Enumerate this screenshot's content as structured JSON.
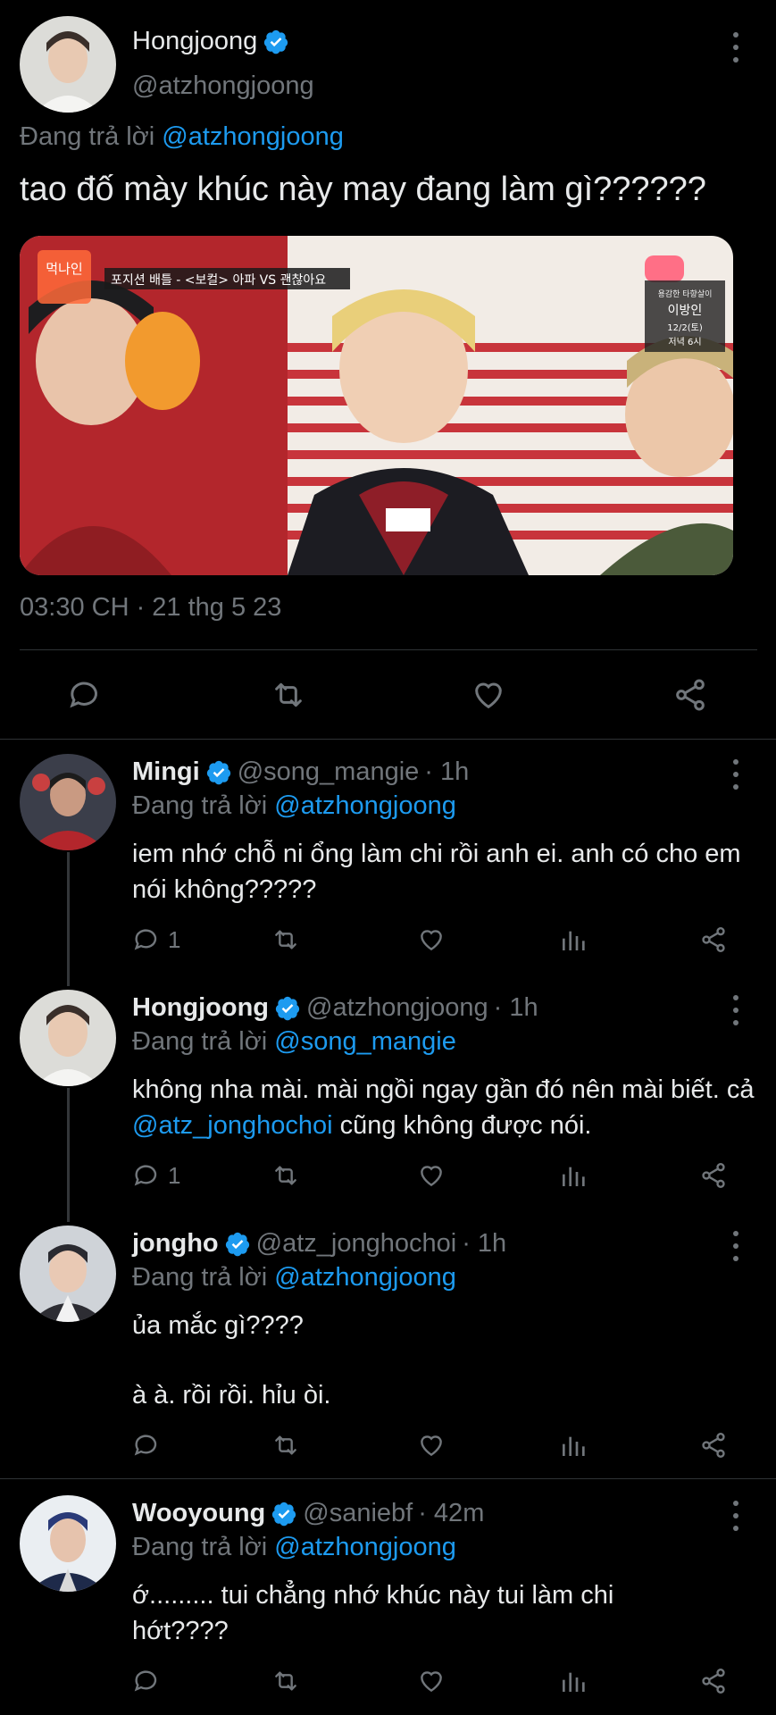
{
  "main_tweet": {
    "name": "Hongjoong",
    "handle": "@atzhongjoong",
    "replying_prefix": "Đang trả lời",
    "replying_to": "@atzhongjoong",
    "text": "tao đố mày khúc này may đang làm gì??????",
    "media_overlay": {
      "top_left_badge": "먹나인",
      "banner": "포지션 배틀 - <보컬> 아파 VS 괜찮아요",
      "top_right_small": "용감한 타향살이",
      "top_right_name": "이방인",
      "top_right_date": "12/2(토)",
      "top_right_time": "저녁 6시"
    },
    "timestamp": "03:30 CH · 21 thg 5 23"
  },
  "replies": [
    {
      "name": "Mingi",
      "handle": "@song_mangie",
      "time": "· 1h",
      "replying_prefix": "Đang trả lời",
      "replying_to": "@atzhongjoong",
      "text": "iem nhớ chỗ ni ổng làm chi rồi anh ei. anh có cho em nói không?????",
      "reply_count": "1"
    },
    {
      "name": "Hongjoong",
      "handle": "@atzhongjoong",
      "time": "· 1h",
      "replying_prefix": "Đang trả lời",
      "replying_to": "@song_mangie",
      "text_before": "không nha mài. mài ngồi ngay gần đó nên mài biết. cả ",
      "text_mention": "@atz_jonghochoi",
      "text_after": " cũng không được nói.",
      "reply_count": "1"
    },
    {
      "name": "jongho",
      "handle": "@atz_jonghochoi",
      "time": "· 1h",
      "replying_prefix": "Đang trả lời",
      "replying_to": "@atzhongjoong",
      "text_line1": "ủa mắc gì????",
      "text_line2": "à à. rồi rồi. hỉu òi.",
      "reply_count": ""
    },
    {
      "name": "Wooyoung",
      "handle": "@saniebf",
      "time": "· 42m",
      "replying_prefix": "Đang trả lời",
      "replying_to": "@atzhongjoong",
      "text": "ớ......... tui chẳng nhớ khúc này tui làm chi hớt????",
      "reply_count": ""
    }
  ],
  "colors": {
    "background": "#000000",
    "text": "#e7e9ea",
    "muted": "#71767b",
    "link": "#1d9bf0",
    "verified": "#1d9bf0"
  },
  "icons": [
    "more-icon",
    "verified-icon",
    "reply-icon",
    "retweet-icon",
    "like-icon",
    "share-icon",
    "views-icon"
  ]
}
